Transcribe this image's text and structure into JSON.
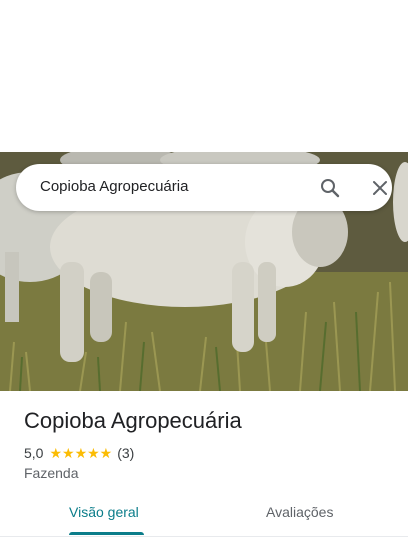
{
  "search": {
    "query": "Copioba Agropecuária",
    "search_icon": "search-icon",
    "clear_icon": "close-icon"
  },
  "hero": {
    "image": "photo-cattle-in-pasture"
  },
  "place": {
    "name": "Copioba Agropecuária",
    "rating": "5,0",
    "stars": "★★★★★",
    "review_count": "(3)",
    "category": "Fazenda"
  },
  "tabs": [
    {
      "label": "Visão geral",
      "selected": true
    },
    {
      "label": "Avaliações",
      "selected": false
    }
  ],
  "colors": {
    "accent": "#0b7d8a",
    "star": "#fbbc04"
  }
}
